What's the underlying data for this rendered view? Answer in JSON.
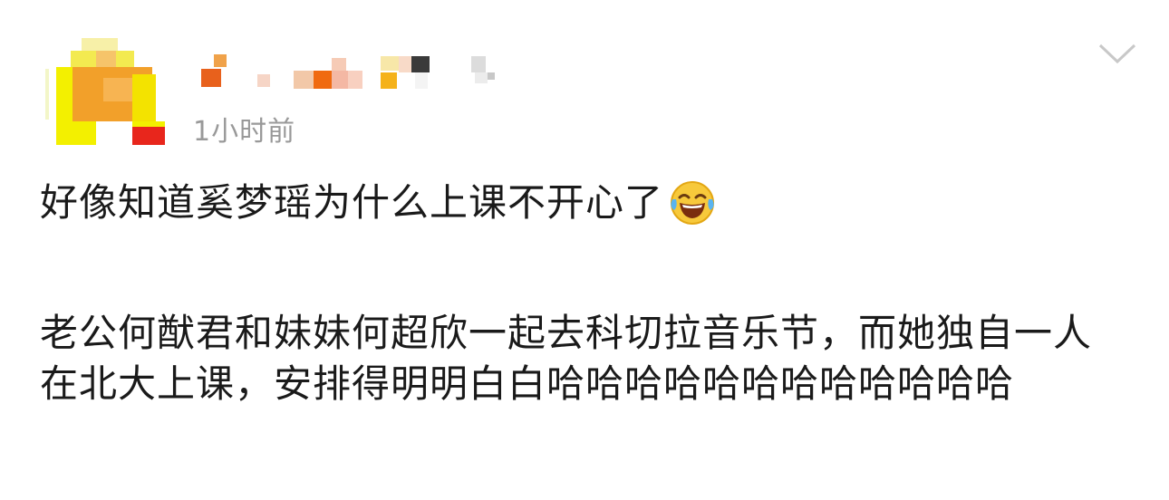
{
  "post": {
    "timestamp": "1小时前",
    "line1": "好像知道奚梦瑶为什么上课不开心了",
    "emoji_icon": "laughing-with-tears-emoji",
    "paragraph2": "老公何猷君和妹妹何超欣一起去科切拉音乐节，而她独自一人在北大上课，安排得明明白白哈哈哈哈哈哈哈哈哈哈哈哈",
    "menu_icon": "chevron-down-icon"
  },
  "colors": {
    "text": "#1a1a1a",
    "timestamp": "#999999",
    "chevron": "#c8c8c8",
    "avatar_orange": "#f2a02a",
    "avatar_yellow": "#f3f000",
    "avatar_red": "#e8261c"
  }
}
